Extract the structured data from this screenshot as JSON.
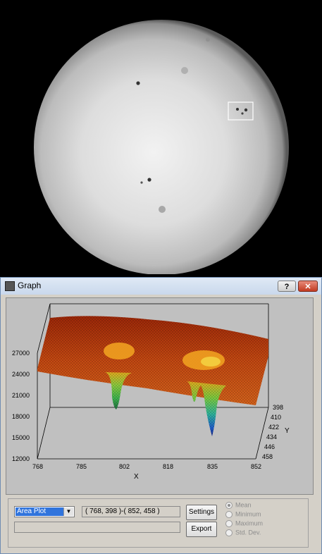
{
  "window": {
    "title": "Graph",
    "help_label": "?",
    "close_label": "✕"
  },
  "plot": {
    "z_ticks": [
      "27000",
      "24000",
      "21000",
      "18000",
      "15000",
      "12000"
    ],
    "x_ticks": [
      "768",
      "785",
      "802",
      "818",
      "835",
      "852"
    ],
    "y_ticks": [
      "398",
      "410",
      "422",
      "434",
      "446",
      "458"
    ],
    "x_label": "X",
    "y_label": "Y"
  },
  "controls": {
    "plot_type": "Area Plot",
    "range": "( 768, 398 )-( 852, 458 )",
    "settings_label": "Settings",
    "export_label": "Export",
    "radios": [
      {
        "label": "Mean",
        "selected": true
      },
      {
        "label": "Minimum",
        "selected": false
      },
      {
        "label": "Maximum",
        "selected": false
      },
      {
        "label": "Std. Dev.",
        "selected": false
      }
    ]
  },
  "colors": {
    "surface_top": "#b83a10",
    "surface_mid": "#f0a020",
    "valley_green": "#50c040",
    "valley_blue": "#2040c0"
  }
}
